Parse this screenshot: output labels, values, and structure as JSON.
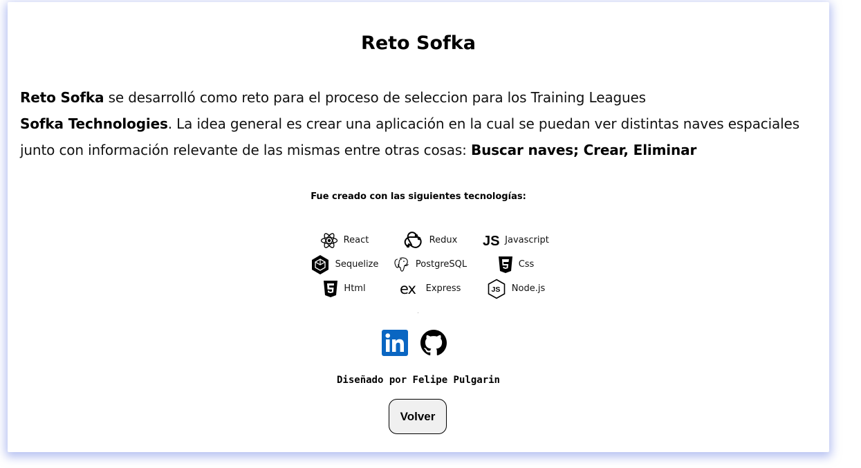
{
  "title": "Reto Sofka",
  "description": {
    "line1_bold": "Reto Sofka",
    "line1_rest": " se desarrolló como reto para el proceso de seleccion para los Training Leagues",
    "line2_bold": "Sofka Technologies",
    "line2_rest": ". La idea general es crear una aplicación en la cual se puedan ver distintas naves espaciales junto con información relevante de las mismas entre otras cosas: ",
    "line3_bold": "Buscar naves; Crear, Eliminar"
  },
  "technologies_heading": "Fue creado con las siguientes tecnologías:",
  "technologies": [
    {
      "label": "React",
      "icon": "react-icon"
    },
    {
      "label": "Redux",
      "icon": "redux-icon"
    },
    {
      "label": "Javascript",
      "icon": "javascript-icon"
    },
    {
      "label": "Sequelize",
      "icon": "sequelize-icon"
    },
    {
      "label": "PostgreSQL",
      "icon": "postgresql-icon"
    },
    {
      "label": "Css",
      "icon": "css3-icon"
    },
    {
      "label": "Html",
      "icon": "html5-icon"
    },
    {
      "label": "Express",
      "icon": "express-icon"
    },
    {
      "label": "Node.js",
      "icon": "nodejs-icon"
    }
  ],
  "socials": [
    {
      "name": "LinkedIn",
      "icon": "linkedin-icon",
      "color": "#0a66c2"
    },
    {
      "name": "GitHub",
      "icon": "github-icon",
      "color": "#000000"
    }
  ],
  "credit": "Diseñado por Felipe Pulgarin",
  "back_button_label": "Volver"
}
